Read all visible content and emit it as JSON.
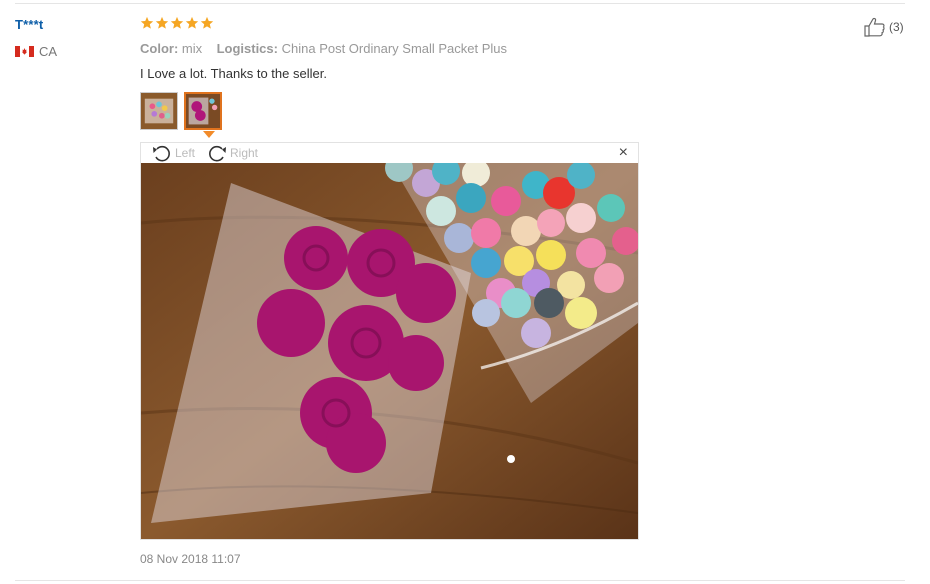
{
  "review": {
    "user_name": "T***t",
    "country_code": "CA",
    "rating": 5,
    "rating_color": "#f5a623",
    "color_label": "Color:",
    "color_value": "mix",
    "logistics_label": "Logistics:",
    "logistics_value": "China Post Ordinary Small Packet Plus",
    "text": "I Love a lot. Thanks to the seller.",
    "helpful_count": "(3)",
    "date": "08 Nov 2018 11:07"
  },
  "viewer": {
    "rotate_left_label": "Left",
    "rotate_right_label": "Right",
    "close_symbol": "×",
    "accent_color": "#f28b2a"
  },
  "icons": [
    "star-icon",
    "thumbs-up-icon",
    "rotate-left-icon",
    "rotate-right-icon",
    "close-icon",
    "flag-icon"
  ]
}
